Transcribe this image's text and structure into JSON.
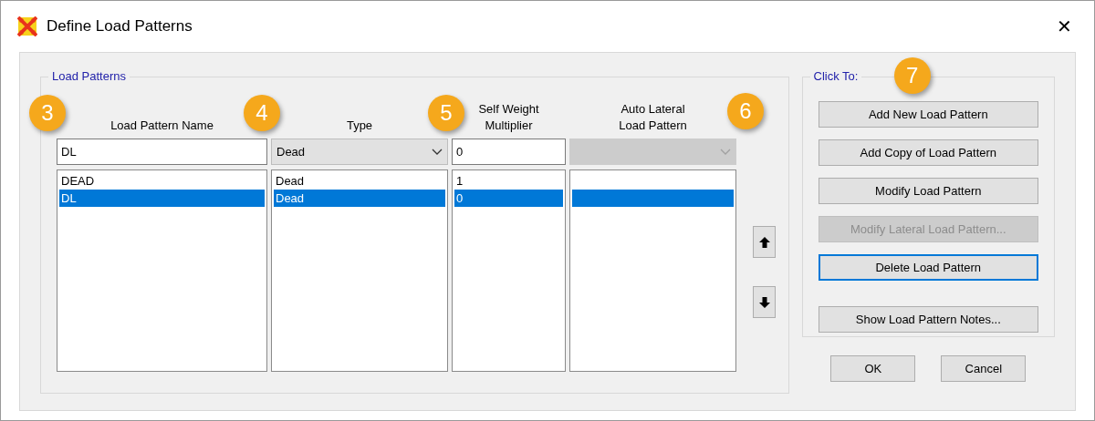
{
  "window": {
    "title": "Define Load Patterns",
    "close": "✕"
  },
  "load_patterns": {
    "title": "Load Patterns",
    "columns": [
      {
        "header": "Load Pattern Name",
        "callout": "3",
        "kind": "text",
        "value": "DL"
      },
      {
        "header": "Type",
        "callout": "4",
        "kind": "dropdown",
        "value": "Dead",
        "disabled": false
      },
      {
        "header": "Self Weight Multiplier",
        "callout": "5",
        "kind": "text",
        "value": "0"
      },
      {
        "header": "Auto Lateral Load Pattern",
        "callout": "6",
        "kind": "dropdown",
        "disabled": true
      }
    ],
    "rows": [
      {
        "cells": [
          "DEAD",
          "Dead",
          "1",
          ""
        ],
        "selected": false
      },
      {
        "cells": [
          "DL",
          "Dead",
          "0",
          ""
        ],
        "selected": true
      }
    ]
  },
  "move_buttons": [
    {
      "kind": "up"
    },
    {
      "kind": "down"
    }
  ],
  "click_to": {
    "title": "Click To:",
    "callout": "7",
    "buttons": [
      {
        "label": "Add New Load Pattern",
        "disabled": false,
        "focused": false
      },
      {
        "label": "Add Copy of Load Pattern",
        "disabled": false,
        "focused": false
      },
      {
        "label": "Modify Load Pattern",
        "disabled": false,
        "focused": false
      },
      {
        "label": "Modify Lateral Load Pattern...",
        "disabled": true,
        "focused": false
      },
      {
        "label": "Delete Load Pattern",
        "disabled": false,
        "focused": true
      },
      {
        "label": "Show Load Pattern Notes...",
        "disabled": false,
        "focused": false
      }
    ]
  },
  "footer_buttons": [
    "OK",
    "Cancel"
  ]
}
